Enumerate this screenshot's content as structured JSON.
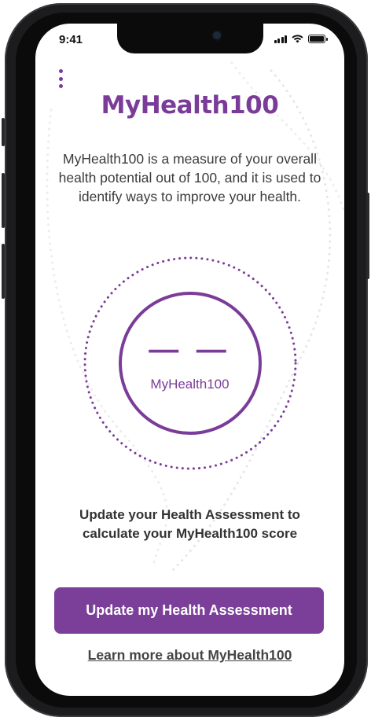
{
  "status_bar": {
    "time": "9:41"
  },
  "header": {
    "menu_icon": "more-vertical-icon",
    "title": "MyHealth100"
  },
  "description": "MyHealth100 is a measure of your overall health potential out of 100, and it is used to identify ways to improve your health.",
  "gauge": {
    "score": "— —",
    "label": "MyHealth100"
  },
  "prompt": "Update your Health Assessment to calculate your MyHealth100 score",
  "actions": {
    "update_button": "Update my Health Assessment",
    "learn_more_link": "Learn more about MyHealth100"
  },
  "colors": {
    "accent": "#7a3c98",
    "button": "#7b3f99",
    "text": "#333333"
  }
}
